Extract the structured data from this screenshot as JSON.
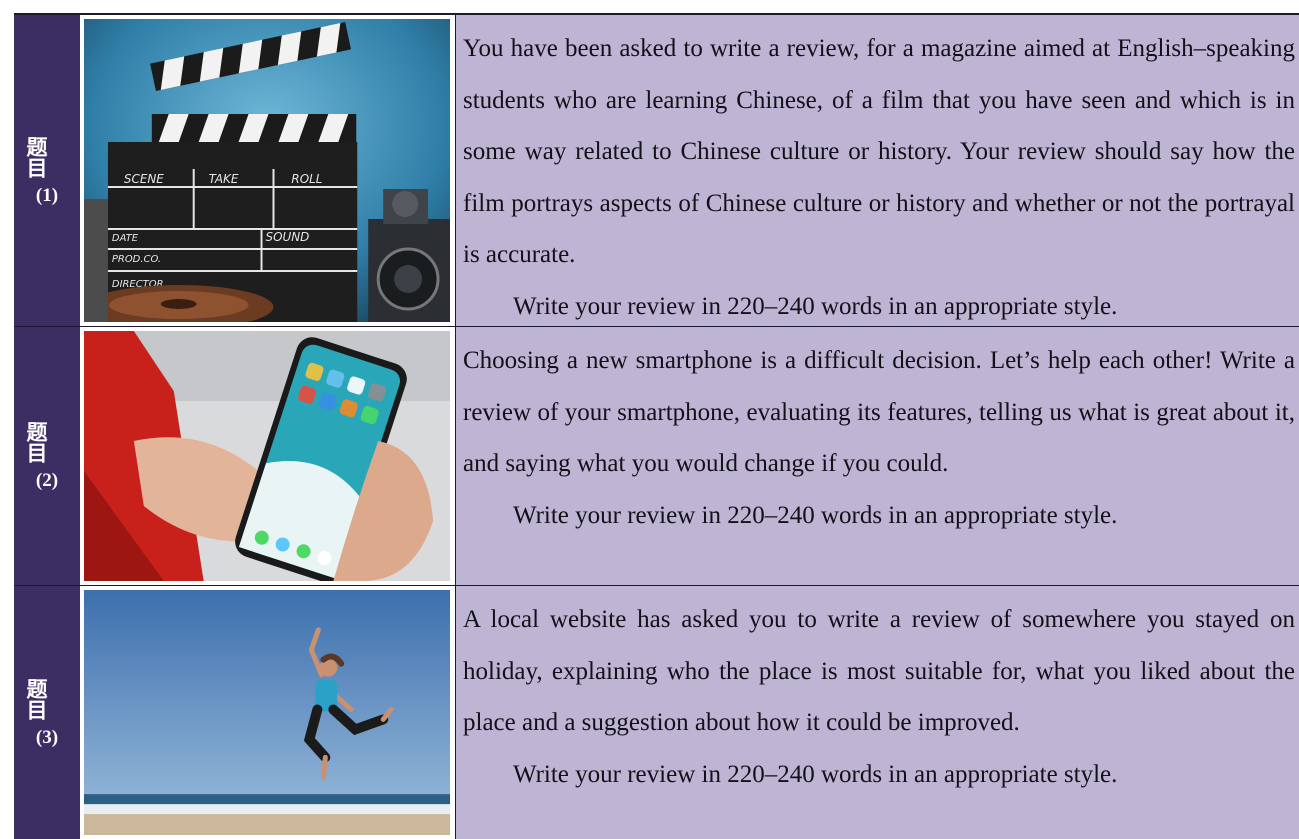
{
  "rows": [
    {
      "label_cn": "题目",
      "label_num": "(1)",
      "prompt": "You have been asked to write a review, for a magazine aimed at English–speaking students who are learning Chinese, of a film that you have seen and which is in some way related to Chinese culture or history. Your review should say how the film portrays aspects of Chinese culture or history and whether or not the portrayal is accurate.",
      "instruction": "Write your review in 220–240 words in an appropriate style.",
      "photo": {
        "icon": "clapperboard-icon",
        "board_labels": [
          "SCENE",
          "TAKE",
          "ROLL",
          "DATE",
          "SOUND",
          "PROD.CO.",
          "DIRECTOR"
        ]
      }
    },
    {
      "label_cn": "题目",
      "label_num": "(2)",
      "prompt": "Choosing a new smartphone is a difficult decision. Let’s help each other!  Write a review of your smartphone, evaluating its features, telling us what is great about it, and saying what you would change if you could.",
      "instruction": "Write your review in 220–240 words in an appropriate style.",
      "photo": {
        "icon": "smartphone-icon"
      }
    },
    {
      "label_cn": "题目",
      "label_num": "(3)",
      "prompt": "A local website has asked you to write a review of somewhere you stayed on holiday, explaining who the place is most suitable for, what you liked about the place and a suggestion about how it could be improved.",
      "instruction": "Write your review in 220–240 words in an appropriate style.",
      "photo": {
        "icon": "beach-jump-icon"
      }
    }
  ],
  "colors": {
    "label_bg": "#3c2d63",
    "text_bg": "#beb4d4",
    "border": "#1d1a2e"
  }
}
